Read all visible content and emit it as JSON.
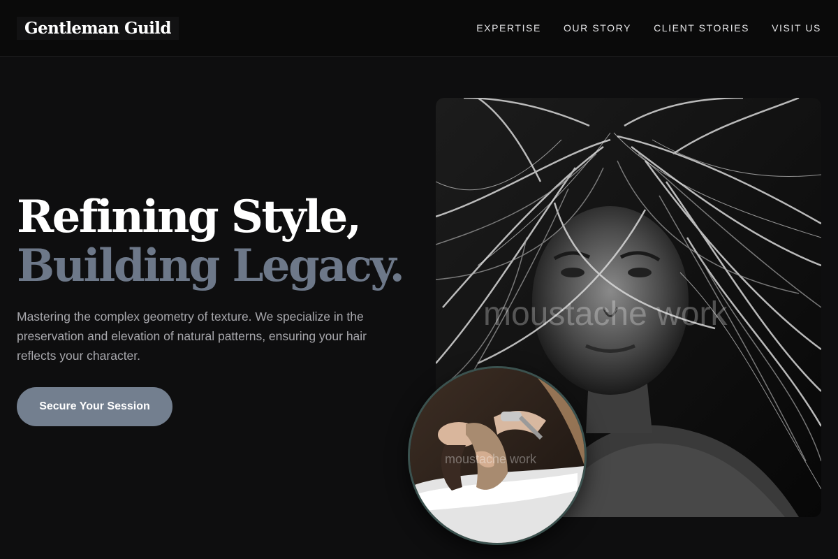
{
  "brand": {
    "name": "Gentleman Guild"
  },
  "nav": {
    "items": [
      {
        "label": "EXPERTISE"
      },
      {
        "label": "OUR STORY"
      },
      {
        "label": "CLIENT STORIES"
      },
      {
        "label": "VISIT US"
      }
    ]
  },
  "hero": {
    "headline_line1": "Refining Style,",
    "headline_line2": "Building Legacy.",
    "description": "Mastering the complex geometry of texture. We specialize in the preservation and elevation of natural patterns, ensuring your hair reflects your character.",
    "cta_label": "Secure Your Session"
  },
  "images": {
    "main_watermark": "moustache work",
    "circle_watermark": "moustache work"
  },
  "colors": {
    "background": "#0e0e0f",
    "accent": "#737f8f",
    "headline_secondary": "#6d7889",
    "circle_border": "#3b524f"
  }
}
